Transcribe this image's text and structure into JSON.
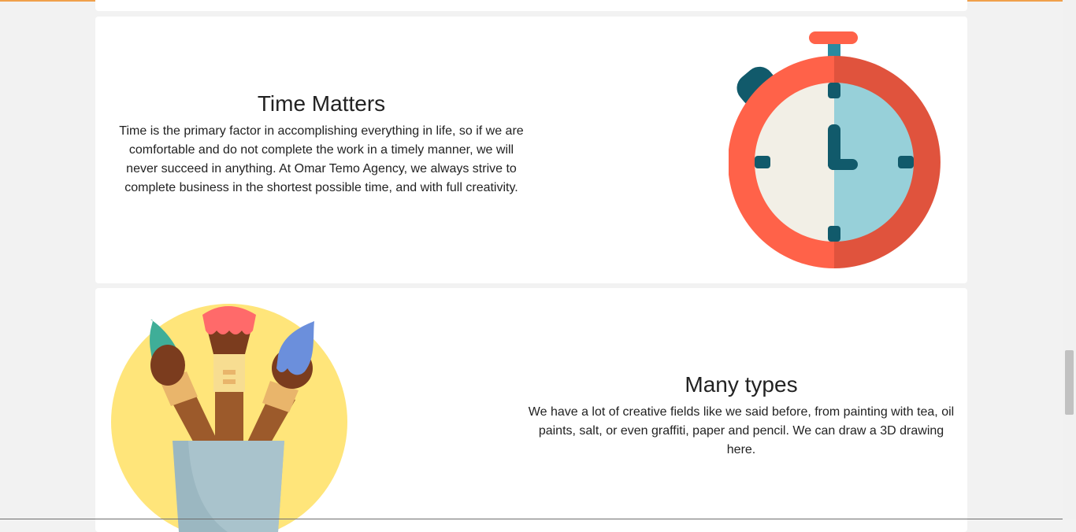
{
  "sections": {
    "time": {
      "title": "Time Matters",
      "body": "Time is the primary factor in accomplishing everything in life, so if we are comfortable and do not complete the work in a timely manner, we will never succeed in anything. At Omar Temo Agency, we always strive to complete business in the shortest possible time, and with full creativity.",
      "illustration": "stopwatch-illustration"
    },
    "types": {
      "title": "Many types",
      "body": "We have a lot of creative fields like we said before, from painting with tea, oil paints, salt, or even graffiti, paper and pencil. We can draw a 3D drawing here.",
      "illustration": "paint-brushes-illustration"
    }
  },
  "colors": {
    "page_bg": "#f2f2f2",
    "card_bg": "#ffffff",
    "accent_line": "#f0a04b",
    "stopwatch_ring": "#ff6249",
    "stopwatch_ring_dark": "#e0533d",
    "clock_face_left": "#f2efe6",
    "clock_face_right": "#97d0d9",
    "clock_hands": "#115a6b",
    "brush_circle": "#ffe57a",
    "cup": "#9bb7c1"
  },
  "scroll": {
    "position_fraction": 0.68
  }
}
